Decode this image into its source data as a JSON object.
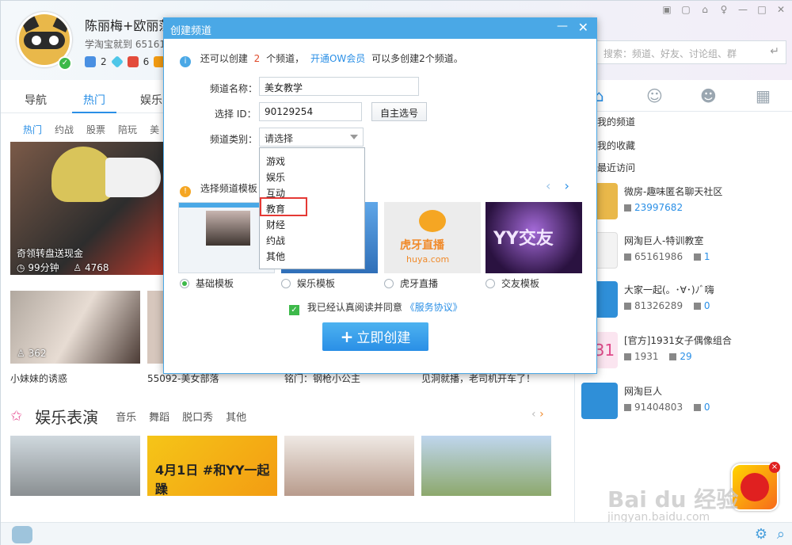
{
  "window": {
    "controls": [
      "▣",
      "▢",
      "⌂",
      "♀",
      "—",
      "□",
      "✕"
    ]
  },
  "user": {
    "name": "陈丽梅+欧丽莎",
    "sub": "学淘宝就到 651619",
    "badges": [
      "2",
      "",
      "6",
      ""
    ]
  },
  "search": {
    "placeholder": "搜索：频道、好友、讨论组、群",
    "enter_glyph": "↵"
  },
  "nav": {
    "tabs": [
      "导航",
      "热门",
      "娱乐"
    ],
    "active": "热门",
    "sub_tabs": [
      "热门",
      "约战",
      "股票",
      "陪玩",
      "美"
    ]
  },
  "content": {
    "big_thumb": {
      "caption": "奇领转盘送现金",
      "duration": "99分钟",
      "viewers": "4768"
    },
    "row2": [
      {
        "viewers": "362",
        "caption": "小妹妹的诱惑"
      },
      {
        "caption": "55092-美女部落"
      },
      {
        "caption": "铭门：钢枪小公主"
      },
      {
        "caption": "见洞就播，老司机开车了！"
      }
    ],
    "section": {
      "title": "娱乐表演",
      "links": [
        "音乐",
        "舞蹈",
        "脱口秀",
        "其他"
      ],
      "arrow_left": "‹",
      "arrow_right": "›"
    },
    "row3": [
      {
        "text": ""
      },
      {
        "text": "4月1日 #和YY一起躁"
      },
      {
        "text": ""
      },
      {
        "text": ""
      }
    ]
  },
  "right_panel": {
    "tabs": [
      "⌂",
      "☺",
      "☻",
      "▦"
    ],
    "links": [
      "我的频道",
      "我的收藏",
      "最近访问"
    ],
    "channels": [
      {
        "name": "微房-趣味匿名聊天社区",
        "id": "",
        "count": "23997682",
        "logo": "yy"
      },
      {
        "name": "网淘巨人-特训教室",
        "id": "65161986",
        "count": "1",
        "logo": "yy-dark"
      },
      {
        "name": "大家一起(。･∀･)ﾉﾞ嗨",
        "id": "81326289",
        "count": "0",
        "logo": "home"
      },
      {
        "name": "[官方]1931女子偶像组合",
        "id": "1931",
        "count": "29",
        "logo": "131"
      },
      {
        "name": "网淘巨人",
        "id": "91404803",
        "count": "0",
        "logo": "home"
      }
    ],
    "logo_131_text": "131"
  },
  "dialog": {
    "title": "创建频道",
    "min_glyph": "—",
    "close_glyph": "✕",
    "info": {
      "prefix": "还可以创建",
      "count": "2",
      "mid": "个频道，",
      "link": "开通OW会员",
      "suffix": "可以多创建2个频道。"
    },
    "fields": {
      "name_label": "频道名称：",
      "name_value": "美女教学",
      "id_label": "选择 ID：",
      "id_value": "90129254",
      "id_button": "自主选号",
      "category_label": "频道类别：",
      "category_value": "请选择"
    },
    "category_options": [
      "游戏",
      "娱乐",
      "互动",
      "教育",
      "财经",
      "约战",
      "其他"
    ],
    "highlighted_option": "教育",
    "template_label": "选择频道模板：",
    "template_arrows": {
      "left": "‹",
      "right": "›"
    },
    "templates": [
      {
        "label": "基础模板",
        "checked": true
      },
      {
        "label": "娱乐模板",
        "checked": false
      },
      {
        "label": "虎牙直播",
        "checked": false,
        "logo_text": "虎牙直播",
        "logo_sub": "huya.com"
      },
      {
        "label": "交友模板",
        "checked": false,
        "logo_text": "YY交友"
      }
    ],
    "agree": {
      "text": "我已经认真阅读并同意",
      "link": "《服务协议》"
    },
    "create_button": "立即创建"
  },
  "watermark": {
    "text": "Bai du 经验",
    "url": "jingyan.baidu.com"
  },
  "colors": {
    "accent": "#2a8fe6",
    "dialog_title": "#4aa8e6",
    "highlight_border": "#e53935",
    "check_green": "#3db94a"
  }
}
